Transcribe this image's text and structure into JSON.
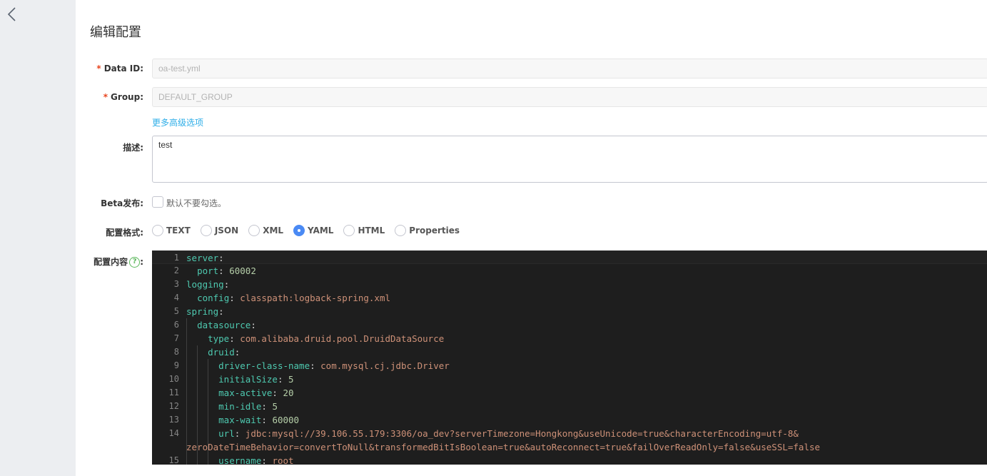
{
  "page_title": "编辑配置",
  "form": {
    "data_id": {
      "required_mark": "*",
      "label": "Data ID:",
      "value": "oa-test.yml"
    },
    "group": {
      "required_mark": "*",
      "label": "Group:",
      "value": "DEFAULT_GROUP"
    },
    "more_link": "更多高级选项",
    "description": {
      "label": "描述:",
      "value": "test"
    },
    "beta": {
      "label": "Beta发布:",
      "checkbox_label": "默认不要勾选。",
      "checked": false
    },
    "format": {
      "label": "配置格式:",
      "options": [
        "TEXT",
        "JSON",
        "XML",
        "YAML",
        "HTML",
        "Properties"
      ],
      "selected": "YAML"
    },
    "content": {
      "label": "配置内容",
      "help_glyph": "?",
      "colon": ":"
    }
  },
  "editor": {
    "lines": [
      {
        "n": "1",
        "indent": "",
        "key": "server",
        "val": "",
        "vtype": ""
      },
      {
        "n": "2",
        "indent": "  ",
        "key": "port",
        "val": "60002",
        "vtype": "num"
      },
      {
        "n": "3",
        "indent": "",
        "key": "logging",
        "val": "",
        "vtype": ""
      },
      {
        "n": "4",
        "indent": "  ",
        "key": "config",
        "val": "classpath:logback-spring.xml",
        "vtype": "str"
      },
      {
        "n": "5",
        "indent": "",
        "key": "spring",
        "val": "",
        "vtype": ""
      },
      {
        "n": "6",
        "indent": "  ",
        "key": "datasource",
        "val": "",
        "vtype": ""
      },
      {
        "n": "7",
        "indent": "    ",
        "key": "type",
        "val": "com.alibaba.druid.pool.DruidDataSource",
        "vtype": "str"
      },
      {
        "n": "8",
        "indent": "    ",
        "key": "druid",
        "val": "",
        "vtype": ""
      },
      {
        "n": "9",
        "indent": "      ",
        "key": "driver-class-name",
        "val": "com.mysql.cj.jdbc.Driver",
        "vtype": "str"
      },
      {
        "n": "10",
        "indent": "      ",
        "key": "initialSize",
        "val": "5",
        "vtype": "num"
      },
      {
        "n": "11",
        "indent": "      ",
        "key": "max-active",
        "val": "20",
        "vtype": "num"
      },
      {
        "n": "12",
        "indent": "      ",
        "key": "min-idle",
        "val": "5",
        "vtype": "num"
      },
      {
        "n": "13",
        "indent": "      ",
        "key": "max-wait",
        "val": "60000",
        "vtype": "num"
      },
      {
        "n": "14",
        "indent": "      ",
        "key": "url",
        "val": "jdbc:mysql://39.106.55.179:3306/oa_dev?serverTimezone=Hongkong&useUnicode=true&characterEncoding=utf-8&",
        "vtype": "str"
      },
      {
        "n": "",
        "indent": "",
        "key": "",
        "val": "zeroDateTimeBehavior=convertToNull&transformedBitIsBoolean=true&autoReconnect=true&failOverReadOnly=false&useSSL=false",
        "vtype": "str"
      },
      {
        "n": "15",
        "indent": "      ",
        "key": "username",
        "val": "root",
        "vtype": "str"
      }
    ]
  }
}
